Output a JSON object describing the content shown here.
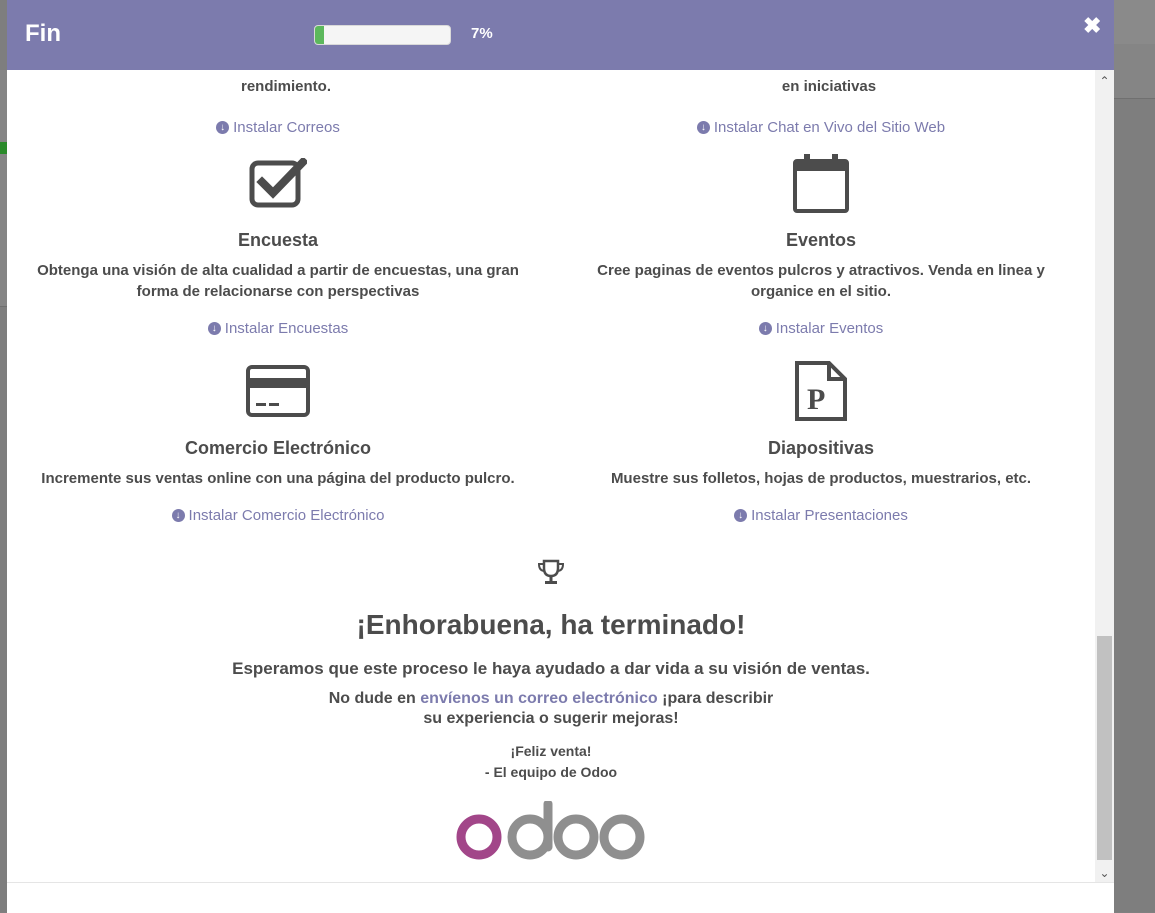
{
  "modal": {
    "title": "Fin",
    "progress_label": "7%",
    "progress_fraction": 0.07,
    "close_symbol": "✖"
  },
  "partial_rows": {
    "left": "rendimiento.",
    "right": "en iniciativas",
    "left_link": "Instalar Correos",
    "right_link": "Instalar Chat en Vivo del Sitio Web"
  },
  "apps": [
    {
      "title": "Encuesta",
      "desc_line1": "Obtenga una visión de alta cualidad a partir de encuestas, una gran",
      "desc_line2": "forma de relacionarse con perspectivas",
      "link": "Instalar Encuestas",
      "icon": "checkbox-icon"
    },
    {
      "title": "Eventos",
      "desc_line1": "Cree paginas de eventos pulcros y atractivos. Venda en linea y",
      "desc_line2": "organice en el sitio.",
      "link": "Instalar Eventos",
      "icon": "calendar-icon"
    },
    {
      "title": "Comercio Electrónico",
      "desc_line1": "Incremente sus ventas online con una página del producto pulcro.",
      "desc_line2": "",
      "link": "Instalar Comercio Electrónico",
      "icon": "credit-card-icon"
    },
    {
      "title": "Diapositivas",
      "desc_line1": "Muestre sus folletos, hojas de productos, muestrarios, etc.",
      "desc_line2": "",
      "link": "Instalar Presentaciones",
      "icon": "slides-file-icon"
    }
  ],
  "finish": {
    "icon": "trophy-icon",
    "headline": "¡Enhorabuena, ha terminado!",
    "line1": "Esperamos que este proceso le haya ayudado a dar vida a su visión de ventas.",
    "line2_before": "No dude en ",
    "line2_link": "envíenos un correo electrónico",
    "line2_after": " ¡para describir",
    "line3": "su experiencia o sugerir mejoras!",
    "sign1": "¡Feliz venta!",
    "sign2": "- El equipo de Odoo",
    "logo_text": "odoo"
  },
  "colors": {
    "brand": "#7c7bad",
    "logo_purple": "#a24689",
    "logo_gray": "#8f8f8f",
    "progress": "#5cb85c"
  }
}
